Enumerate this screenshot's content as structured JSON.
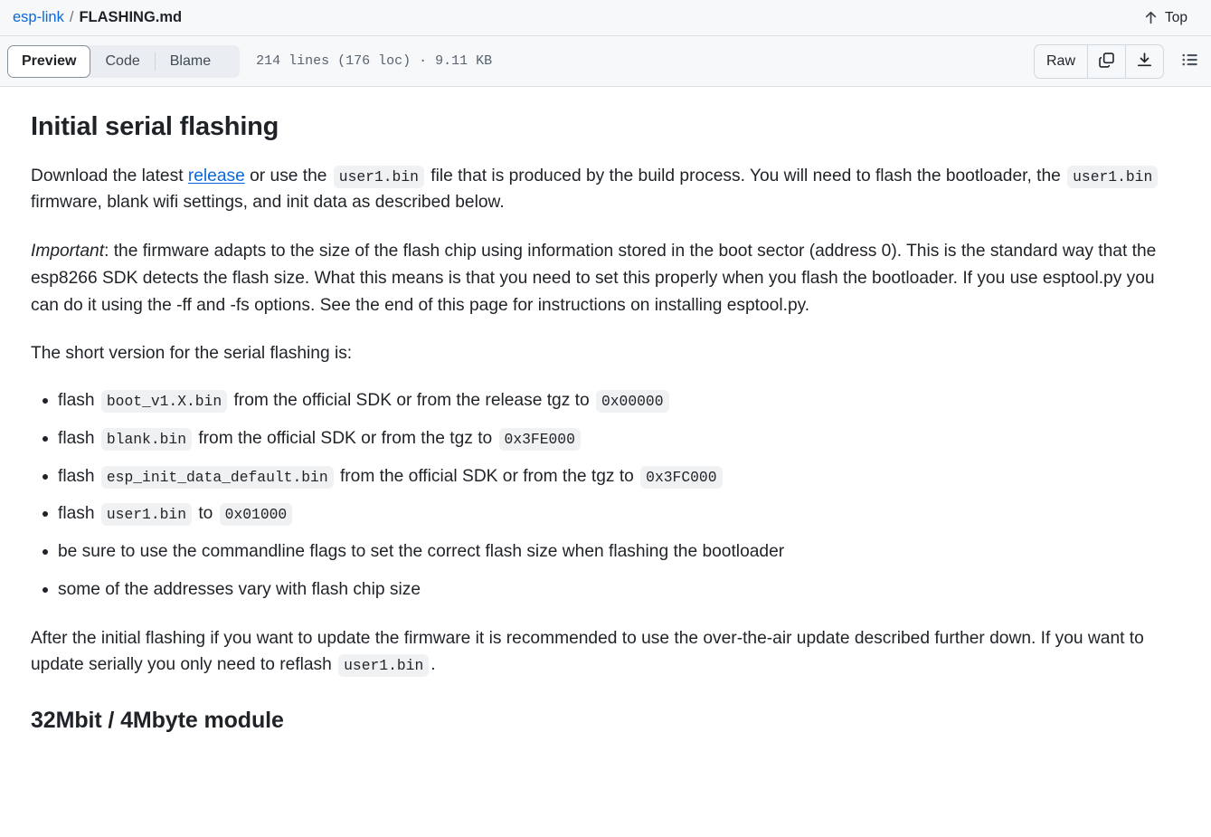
{
  "breadcrumb": {
    "repo": "esp-link",
    "separator": "/",
    "filename": "FLASHING.md",
    "top_label": "Top",
    "top_icon": "arrow-up-icon"
  },
  "toolbar": {
    "tabs": [
      {
        "label": "Preview",
        "active": true
      },
      {
        "label": "Code",
        "active": false
      },
      {
        "label": "Blame",
        "active": false
      }
    ],
    "file_meta": "214 lines (176 loc) · 9.11 KB",
    "raw_label": "Raw",
    "copy_icon": "copy-icon",
    "download_icon": "download-icon",
    "outline_icon": "list-unordered-icon"
  },
  "content": {
    "h1": "Initial serial flashing",
    "p1": {
      "a": "Download the latest ",
      "link": "release",
      "b": " or use the ",
      "code1": "user1.bin",
      "c": " file that is produced by the build process. You will need to flash the bootloader, the ",
      "code2": "user1.bin",
      "d": " firmware, blank wifi settings, and init data as described below."
    },
    "p2": {
      "em": "Important",
      "rest": ": the firmware adapts to the size of the flash chip using information stored in the boot sector (address 0). This is the standard way that the esp8266 SDK detects the flash size. What this means is that you need to set this properly when you flash the bootloader. If you use esptool.py you can do it using the -ff and -fs options. See the end of this page for instructions on installing esptool.py."
    },
    "p3": "The short version for the serial flashing is:",
    "list": [
      {
        "a": "flash ",
        "code1": "boot_v1.X.bin",
        "b": " from the official SDK or from the release tgz to ",
        "code2": "0x00000",
        "c": ""
      },
      {
        "a": "flash ",
        "code1": "blank.bin",
        "b": " from the official SDK or from the tgz to ",
        "code2": "0x3FE000",
        "c": ""
      },
      {
        "a": "flash ",
        "code1": "esp_init_data_default.bin",
        "b": " from the official SDK or from the tgz to ",
        "code2": "0x3FC000",
        "c": ""
      },
      {
        "a": "flash ",
        "code1": "user1.bin",
        "b": " to ",
        "code2": "0x01000",
        "c": ""
      },
      {
        "a": "be sure to use the commandline flags to set the correct flash size when flashing the bootloader",
        "code1": "",
        "b": "",
        "code2": "",
        "c": ""
      },
      {
        "a": "some of the addresses vary with flash chip size",
        "code1": "",
        "b": "",
        "code2": "",
        "c": ""
      }
    ],
    "p4": {
      "a": "After the initial flashing if you want to update the firmware it is recommended to use the over-the-air update described further down. If you want to update serially you only need to reflash ",
      "code1": "user1.bin",
      "b": "."
    },
    "h2": "32Mbit / 4Mbyte module"
  },
  "colors": {
    "link": "#0969da",
    "header_bg": "#f6f8fa",
    "border": "#d8dee4",
    "code_bg": "#eff1f3",
    "text": "#1f2328",
    "muted": "#59636e"
  }
}
